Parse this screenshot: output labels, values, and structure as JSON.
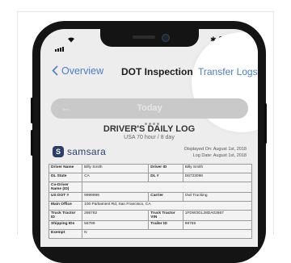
{
  "status_bar": {
    "bluetooth": "✱"
  },
  "nav": {
    "back_label": "Overview",
    "title": "DOT Inspection",
    "transfer_label": "Transfer Logs"
  },
  "date_bar": {
    "label": "Today"
  },
  "log": {
    "title": "DRIVER'S DAILY LOG",
    "subtitle": "USA 70 hour / 8 day",
    "logo": "samsara",
    "displayed_on": "Displayed On: August 1st, 2018",
    "log_date": "Log Date: August 1st, 2018"
  },
  "table": {
    "rows": [
      [
        "Driver Name",
        "Billy Smith",
        "Driver ID",
        "Billy Smith"
      ],
      [
        "DL State",
        "CA",
        "DL #",
        "D6723098"
      ],
      [
        "Co-Driver Name (ID)",
        "",
        "",
        ""
      ],
      [
        "US DOT #",
        "9999999",
        "Carrier",
        "Owl Trucking"
      ],
      [
        "Main Office",
        "100 Parliament Rd, San Francisco, CA",
        "",
        ""
      ],
      [
        "Truck Tractor ID",
        "286762",
        "Truck Tractor VIN",
        "1FDW3GL28DA02867"
      ],
      [
        "Shipping IDs",
        "56789",
        "Trailer ID",
        "98765"
      ],
      [
        "Exempt",
        "N",
        "",
        ""
      ]
    ]
  },
  "colors": {
    "accent": "#4a7ec8",
    "brand": "#2b3e6b"
  }
}
